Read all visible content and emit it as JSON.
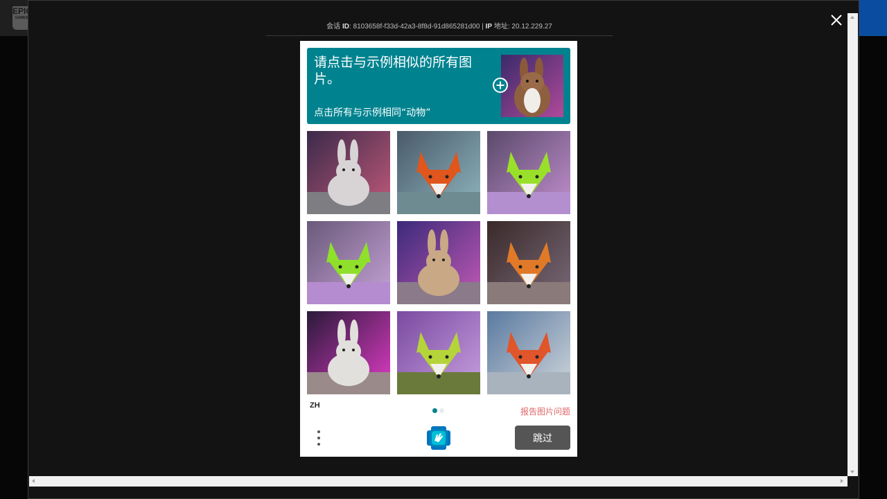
{
  "topbar": {
    "logo_text": "EPIC",
    "logo_sub": "GAMES"
  },
  "session": {
    "id_prefix": "会话",
    "id_label": "ID",
    "id_value": "8103658f-f33d-42a3-8f8d-91d865281d00",
    "separator": " | ",
    "ip_label": "IP",
    "ip_prefix": "地址",
    "ip_value": "20.12.229.27"
  },
  "challenge": {
    "prompt_title": "请点击与示例相似的所有图片。",
    "prompt_sub": "点击所有与示例相同“动物”",
    "language": "ZH",
    "report_label": "报告图片问题",
    "submit_label": "跳过",
    "pager": {
      "current": 1,
      "total": 2
    },
    "colors": {
      "accent": "#00838f",
      "button": "#555555",
      "report": "#e06666"
    },
    "tiles": [
      {
        "icon": "rabbit",
        "bg1": "#3b2a4a",
        "bg2": "#c45a7a",
        "body": "#d8d4d6",
        "ground": "#7d7d82"
      },
      {
        "icon": "fox",
        "bg1": "#4a5a6a",
        "bg2": "#8fb7bf",
        "body": "#e0561c",
        "ground": "#6f8b92"
      },
      {
        "icon": "fox",
        "bg1": "#5a4a6a",
        "bg2": "#c38fd0",
        "body": "#9ae02a",
        "ground": "#b48fd0"
      },
      {
        "icon": "fox",
        "bg1": "#6a5a7a",
        "bg2": "#c7a3d8",
        "body": "#8fe02a",
        "ground": "#b58ccf"
      },
      {
        "icon": "rabbit",
        "bg1": "#3b2a7a",
        "bg2": "#c45ab5",
        "body": "#c9a885",
        "ground": "#8a7a8a"
      },
      {
        "icon": "fox",
        "bg1": "#3a2a2a",
        "bg2": "#7a6a7a",
        "body": "#e07a28",
        "ground": "#8a7a7a"
      },
      {
        "icon": "rabbit",
        "bg1": "#2a1a3a",
        "bg2": "#e33cc8",
        "body": "#e2e0dc",
        "ground": "#9a8a8a"
      },
      {
        "icon": "fox",
        "bg1": "#7a4aa0",
        "bg2": "#c8a0e0",
        "body": "#b5d43a",
        "ground": "#6a7a3a"
      },
      {
        "icon": "fox",
        "bg1": "#5a7aa0",
        "bg2": "#d0d6dc",
        "body": "#e0552a",
        "ground": "#a9b3bd"
      }
    ]
  }
}
